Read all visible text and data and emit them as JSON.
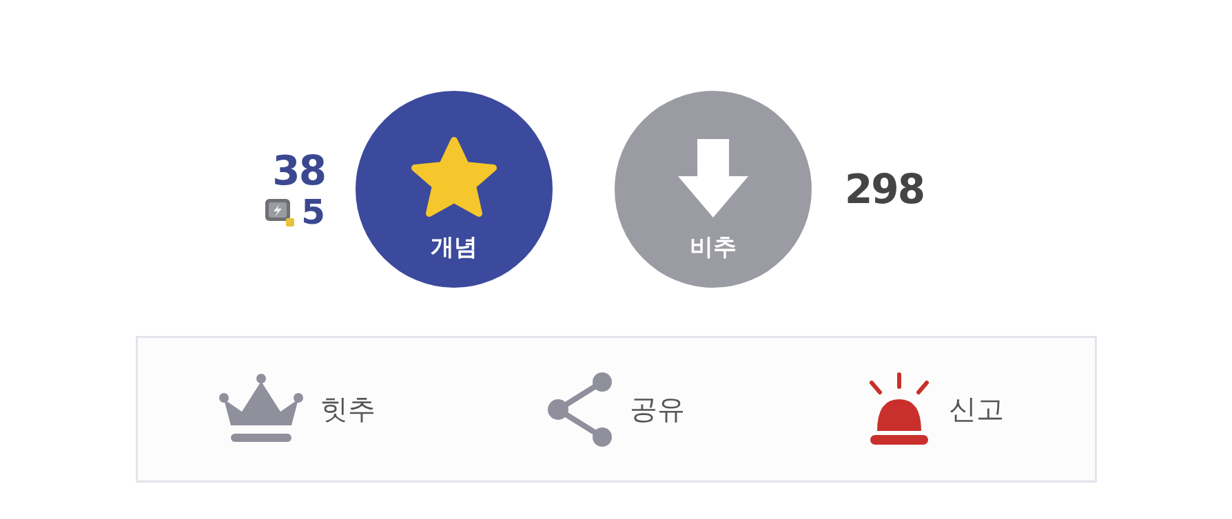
{
  "vote": {
    "up": {
      "label": "개념",
      "count": "38",
      "fixed_count": "5"
    },
    "down": {
      "label": "비추",
      "count": "298"
    }
  },
  "actions": [
    {
      "kind": "crown",
      "label": "힛추"
    },
    {
      "kind": "share",
      "label": "공유"
    },
    {
      "kind": "siren",
      "label": "신고"
    }
  ]
}
